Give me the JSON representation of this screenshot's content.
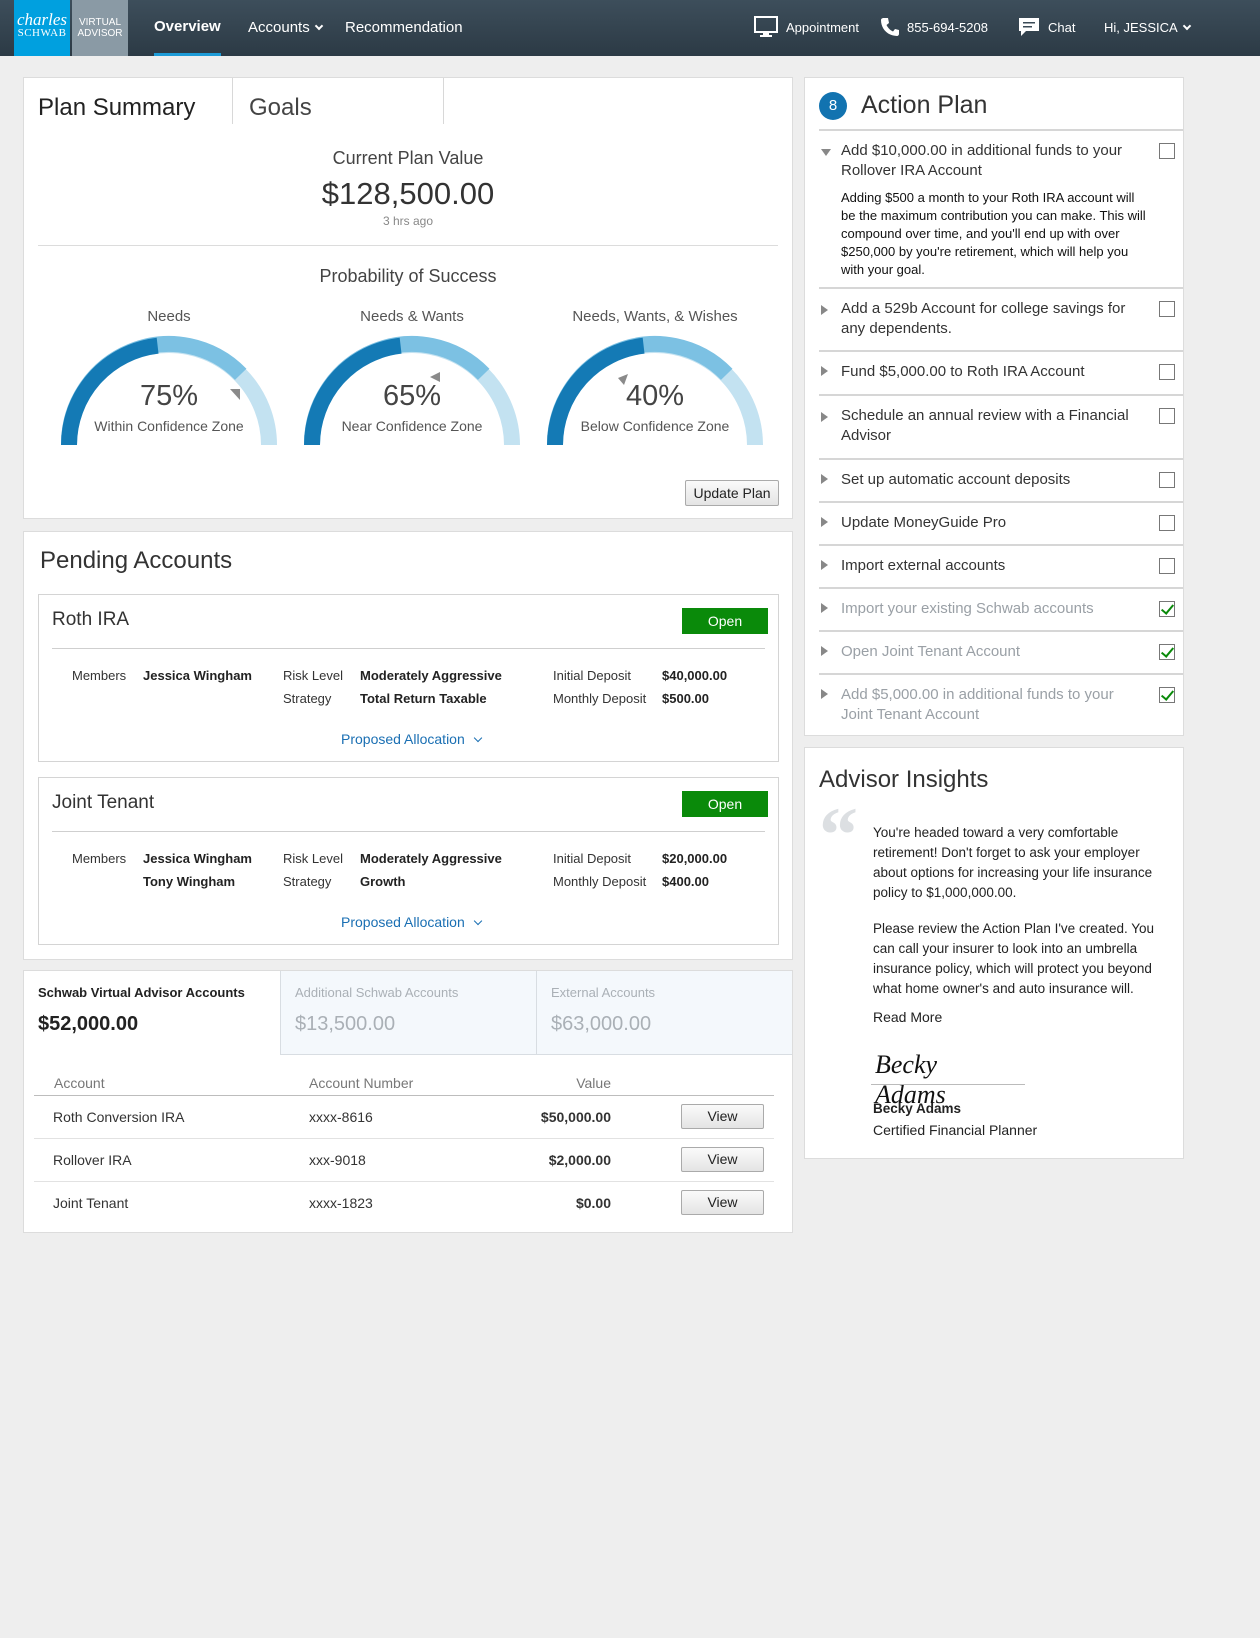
{
  "brand": {
    "logo_line1": "charles",
    "logo_line2": "SCHWAB",
    "product_line1": "VIRTUAL",
    "product_line2": "ADVISOR",
    "primary_color": "#00a0df",
    "accent_color": "#1273b0"
  },
  "nav": {
    "items": [
      {
        "label": "Overview",
        "active": true
      },
      {
        "label": "Accounts",
        "dropdown": true
      },
      {
        "label": "Recommendation"
      }
    ],
    "appointment_label": "Appointment",
    "phone": "855-694-5208",
    "chat_label": "Chat",
    "user_greeting": "Hi, JESSICA",
    "icons": {
      "appointment": "monitor-icon",
      "phone": "phone-icon",
      "chat": "chat-bubble-icon",
      "user_menu": "chevron-down-icon"
    }
  },
  "plan_summary": {
    "tabs": [
      {
        "label": "Plan Summary",
        "active": true
      },
      {
        "label": "Goals"
      }
    ],
    "current_value_label": "Current Plan Value",
    "current_value": "$128,500.00",
    "updated": "3 hrs ago",
    "probability_title": "Probability of Success",
    "gauges": [
      {
        "label": "Needs",
        "percent": 75,
        "percent_text": "75%",
        "zone": "Within Confidence Zone",
        "fill_fraction": 0.45
      },
      {
        "label": "Needs & Wants",
        "percent": 65,
        "percent_text": "65%",
        "zone": "Near Confidence Zone",
        "fill_fraction": 0.45
      },
      {
        "label": "Needs, Wants, & Wishes",
        "percent": 40,
        "percent_text": "40%",
        "zone": "Below Confidence Zone",
        "fill_fraction": 0.45
      }
    ],
    "update_button": "Update Plan",
    "gauge_colors": {
      "dark": "#147ab5",
      "mid": "#7cc1e3",
      "light": "#c3e2f1",
      "marker": "#8a8a8a"
    }
  },
  "pending": {
    "title": "Pending Accounts",
    "accounts": [
      {
        "name": "Roth IRA",
        "open_label": "Open",
        "members_label": "Members",
        "members": [
          "Jessica Wingham"
        ],
        "risk_label": "Risk Level",
        "risk": "Moderately Aggressive",
        "strategy_label": "Strategy",
        "strategy": "Total Return Taxable",
        "initial_label": "Initial Deposit",
        "initial": "$40,000.00",
        "monthly_label": "Monthly Deposit",
        "monthly": "$500.00",
        "allocation_link": "Proposed Allocation"
      },
      {
        "name": "Joint Tenant",
        "open_label": "Open",
        "members_label": "Members",
        "members": [
          "Jessica Wingham",
          "Tony Wingham"
        ],
        "risk_label": "Risk Level",
        "risk": "Moderately Aggressive",
        "strategy_label": "Strategy",
        "strategy": "Growth",
        "initial_label": "Initial Deposit",
        "initial": "$20,000.00",
        "monthly_label": "Monthly Deposit",
        "monthly": "$400.00",
        "allocation_link": "Proposed Allocation"
      }
    ]
  },
  "accounts": {
    "tabs": [
      {
        "title": "Schwab Virtual Advisor Accounts",
        "value": "$52,000.00",
        "active": true
      },
      {
        "title": "Additional Schwab Accounts",
        "value": "$13,500.00"
      },
      {
        "title": "External Accounts",
        "value": "$63,000.00"
      }
    ],
    "columns": [
      "Account",
      "Account Number",
      "Value"
    ],
    "rows": [
      {
        "name": "Roth Conversion IRA",
        "number": "xxxx-8616",
        "value": "$50,000.00",
        "action": "View"
      },
      {
        "name": "Rollover IRA",
        "number": "xxx-9018",
        "value": "$2,000.00",
        "action": "View"
      },
      {
        "name": "Joint Tenant",
        "number": "xxxx-1823",
        "value": "$0.00",
        "action": "View"
      }
    ]
  },
  "action_plan": {
    "count": "8",
    "title": "Action Plan",
    "items": [
      {
        "text": "Add $10,000.00 in additional funds to your Rollover IRA Account",
        "expanded": true,
        "checked": false,
        "description": "Adding $500 a month to your Roth IRA account will be the maximum contribution you can make. This will compound over time, and you'll end up with over $250,000 by you're retirement, which will help you with your goal."
      },
      {
        "text": "Add a 529b Account for college savings for any dependents.",
        "checked": false
      },
      {
        "text": "Fund $5,000.00 to Roth IRA Account",
        "checked": false
      },
      {
        "text": "Schedule an annual review with a Financial Advisor",
        "checked": false
      },
      {
        "text": "Set up automatic account deposits",
        "checked": false
      },
      {
        "text": "Update MoneyGuide Pro",
        "checked": false
      },
      {
        "text": "Import external accounts",
        "checked": false
      },
      {
        "text": "Import your existing Schwab accounts",
        "checked": true
      },
      {
        "text": "Open Joint Tenant Account",
        "checked": true
      },
      {
        "text": "Add $5,000.00 in additional funds to your Joint Tenant Account",
        "checked": true
      }
    ]
  },
  "insights": {
    "title": "Advisor Insights",
    "paragraph1": "You're headed toward a very comfortable retirement! Don't forget to ask your employer about options for increasing your life insurance policy to $1,000,000.00.",
    "paragraph2": "Please review the Action Plan I've created. You can call your insurer to look into an umbrella insurance policy, which will protect you beyond what home owner's and auto insurance will.",
    "read_more": "Read More",
    "signature": "Becky Adams",
    "advisor_name": "Becky Adams",
    "advisor_title": "Certified Financial Planner"
  }
}
